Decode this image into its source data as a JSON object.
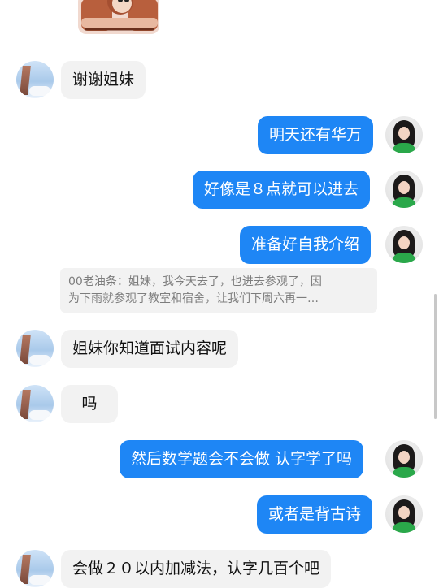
{
  "messages": {
    "m1": "谢谢姐妹",
    "m2": "明天还有华万",
    "m3": "好像是８点就可以进去",
    "m4": "准备好自我介绍",
    "quote_line1": "00老油条：姐妹，我今天去了，也进去参观了，因",
    "quote_line2": "为下雨就参观了教室和宿舍，让我们下周六再一…",
    "m5": "姐妹你知道面试内容呢",
    "m6": "吗",
    "m7": "然后数学题会不会做 认字学了吗",
    "m8": "或者是背古诗",
    "m9": "会做２０以内加减法，认字几百个吧"
  },
  "colors": {
    "outgoing_bubble": "#1e86f5",
    "incoming_bubble": "#f2f2f2"
  },
  "icons": {
    "sticker": "cartoon-sticker-icon"
  }
}
